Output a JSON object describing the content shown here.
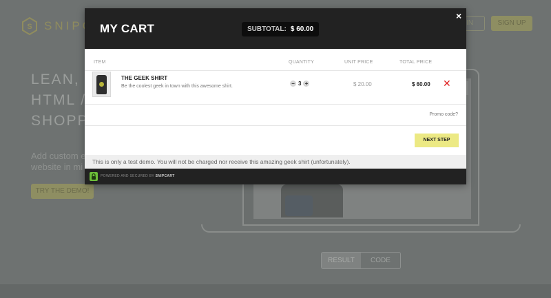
{
  "background": {
    "logo_text": "SNIPCA",
    "login_label": "IN",
    "signup_label": "SIGN UP",
    "hero_lines": [
      "LEAN, P",
      "HTML / J",
      "SHOPPI"
    ],
    "hero_sub": [
      "Add custom e",
      "website in mi"
    ],
    "try_label": "TRY THE DEMO!",
    "toggle": {
      "result": "RESULT",
      "code": "CODE"
    }
  },
  "cart": {
    "title": "MY CART",
    "subtotal_label": "SUBTOTAL:",
    "subtotal_value": "$ 60.00",
    "close_icon": "×",
    "columns": {
      "item": "ITEM",
      "quantity": "QUANTITY",
      "unit_price": "UNIT PRICE",
      "total_price": "TOTAL PRICE"
    },
    "items": [
      {
        "name": "THE GEEK SHIRT",
        "description": "Be the coolest geek in town with this awesome shirt.",
        "quantity": "3",
        "unit_price": "$ 20.00",
        "total_price": "$ 60.00",
        "remove_icon": "✕"
      }
    ],
    "promo_label": "Promo code?",
    "next_step_label": "NEXT STEP",
    "test_note": "This is only a test demo. You will not be charged nor receive this amazing geek shirt (unfortunately).",
    "footer": {
      "powered_by": "POWERED AND SECURED BY",
      "brand": "SNIPCART",
      "lock_color": "#6dbf3a"
    }
  },
  "colors": {
    "accent_yellow": "#ece984",
    "header_dark": "#222222",
    "remove_red": "#e02020"
  }
}
